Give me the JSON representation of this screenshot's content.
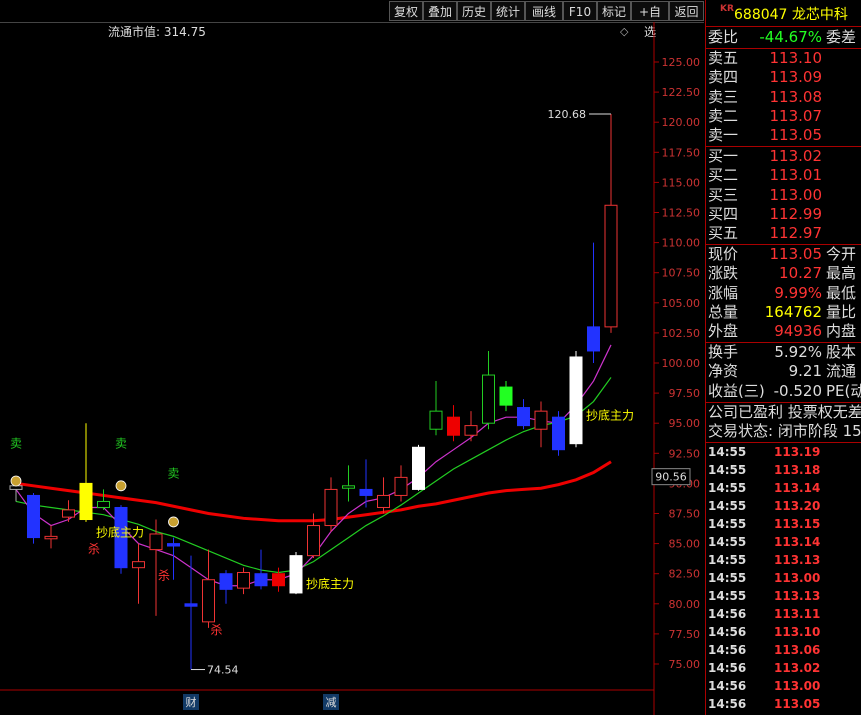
{
  "toolbar": {
    "buttons": [
      "复权",
      "叠加",
      "历史",
      "统计",
      "画线",
      "F10",
      "标记",
      "+自选",
      "返回"
    ]
  },
  "chart_header": {
    "market_cap_label": "流通市值: 314.75",
    "diamond": "◇"
  },
  "chart_data": {
    "type": "candlestick",
    "y_ticks": [
      75.0,
      77.5,
      80.0,
      82.5,
      85.0,
      87.5,
      90.0,
      92.5,
      95.0,
      97.5,
      100.0,
      102.5,
      105.0,
      107.5,
      110.0,
      112.5,
      115.0,
      117.5,
      120.0,
      122.5,
      125.0
    ],
    "ylim": [
      73.5,
      126.5
    ],
    "current_price_label": "90.56",
    "max_label": "120.68",
    "min_label": "74.54",
    "candles": [
      {
        "o": 89.8,
        "c": 89.5,
        "h": 90.5,
        "l": 88.5,
        "color": "gray"
      },
      {
        "o": 89.0,
        "c": 85.5,
        "h": 89.2,
        "l": 85.0,
        "color": "blue"
      },
      {
        "o": 85.6,
        "c": 85.4,
        "h": 86.5,
        "l": 84.6,
        "color": "red"
      },
      {
        "o": 87.2,
        "c": 87.8,
        "h": 88.6,
        "l": 86.8,
        "color": "red"
      },
      {
        "o": 87.0,
        "c": 90.0,
        "h": 95.0,
        "l": 86.8,
        "color": "yellow"
      },
      {
        "o": 88.5,
        "c": 88.0,
        "h": 89.5,
        "l": 87.8,
        "color": "green"
      },
      {
        "o": 88.0,
        "c": 83.0,
        "h": 88.2,
        "l": 82.5,
        "color": "blue"
      },
      {
        "o": 83.0,
        "c": 83.5,
        "h": 85.0,
        "l": 80.0,
        "color": "red"
      },
      {
        "o": 84.5,
        "c": 85.8,
        "h": 87.0,
        "l": 79.0,
        "color": "red"
      },
      {
        "o": 85.0,
        "c": 84.8,
        "h": 85.5,
        "l": 82.0,
        "color": "blue"
      },
      {
        "o": 80.0,
        "c": 79.8,
        "h": 84.0,
        "l": 74.54,
        "color": "blue"
      },
      {
        "o": 78.5,
        "c": 82.0,
        "h": 84.5,
        "l": 78.0,
        "color": "red"
      },
      {
        "o": 82.5,
        "c": 81.2,
        "h": 82.8,
        "l": 80.0,
        "color": "blue"
      },
      {
        "o": 81.3,
        "c": 82.6,
        "h": 83.0,
        "l": 80.8,
        "color": "red"
      },
      {
        "o": 82.5,
        "c": 81.5,
        "h": 84.5,
        "l": 81.2,
        "color": "blue"
      },
      {
        "o": 81.5,
        "c": 82.5,
        "h": 83.0,
        "l": 81.0,
        "color": "redfill"
      },
      {
        "o": 80.9,
        "c": 84.0,
        "h": 84.3,
        "l": 80.8,
        "color": "white"
      },
      {
        "o": 84.0,
        "c": 86.5,
        "h": 87.5,
        "l": 83.8,
        "color": "red"
      },
      {
        "o": 86.5,
        "c": 89.5,
        "h": 90.5,
        "l": 86.0,
        "color": "red"
      },
      {
        "o": 89.6,
        "c": 89.8,
        "h": 91.5,
        "l": 88.5,
        "color": "green"
      },
      {
        "o": 89.5,
        "c": 89.0,
        "h": 92.0,
        "l": 88.0,
        "color": "blue"
      },
      {
        "o": 88.0,
        "c": 89.0,
        "h": 90.5,
        "l": 87.5,
        "color": "red"
      },
      {
        "o": 89.0,
        "c": 90.5,
        "h": 91.5,
        "l": 88.5,
        "color": "red"
      },
      {
        "o": 89.5,
        "c": 93.0,
        "h": 93.2,
        "l": 89.4,
        "color": "white"
      },
      {
        "o": 94.5,
        "c": 96.0,
        "h": 98.5,
        "l": 94.0,
        "color": "green"
      },
      {
        "o": 95.5,
        "c": 94.0,
        "h": 96.5,
        "l": 93.5,
        "color": "redfill"
      },
      {
        "o": 94.0,
        "c": 94.8,
        "h": 96.0,
        "l": 93.5,
        "color": "red"
      },
      {
        "o": 95.0,
        "c": 99.0,
        "h": 101.0,
        "l": 94.5,
        "color": "green"
      },
      {
        "o": 98.0,
        "c": 96.5,
        "h": 98.5,
        "l": 96.0,
        "color": "greenfill"
      },
      {
        "o": 96.3,
        "c": 94.8,
        "h": 97.0,
        "l": 94.5,
        "color": "blue"
      },
      {
        "o": 96.0,
        "c": 94.5,
        "h": 96.8,
        "l": 93.0,
        "color": "red"
      },
      {
        "o": 95.5,
        "c": 92.8,
        "h": 96.0,
        "l": 92.3,
        "color": "blue"
      },
      {
        "o": 93.3,
        "c": 100.5,
        "h": 101.0,
        "l": 93.0,
        "color": "white"
      },
      {
        "o": 101.0,
        "c": 103.0,
        "h": 110.0,
        "l": 100.0,
        "color": "blue"
      },
      {
        "o": 103.0,
        "c": 113.1,
        "h": 120.68,
        "l": 102.5,
        "color": "red"
      }
    ],
    "ma_short": [
      89.5,
      87.5,
      86.5,
      87.0,
      88.0,
      88.0,
      86.5,
      85.0,
      84.5,
      84.0,
      83.0,
      82.0,
      81.5,
      81.5,
      82.0,
      82.0,
      82.5,
      84.0,
      86.0,
      87.5,
      88.5,
      88.8,
      89.5,
      90.5,
      91.8,
      92.8,
      93.8,
      95.0,
      95.5,
      95.5,
      95.2,
      95.0,
      96.5,
      98.5,
      101.5
    ],
    "ma_mid": [
      88.5,
      88.2,
      88.0,
      87.8,
      87.6,
      87.4,
      87.0,
      86.6,
      86.0,
      85.6,
      85.0,
      84.4,
      83.8,
      83.2,
      82.8,
      82.6,
      82.8,
      83.5,
      84.5,
      85.5,
      86.5,
      87.3,
      88.2,
      89.2,
      90.2,
      91.2,
      92.0,
      92.8,
      93.6,
      94.3,
      94.8,
      95.1,
      95.6,
      96.8,
      98.8
    ],
    "ma_long": [
      90.0,
      89.8,
      89.6,
      89.4,
      89.2,
      89.0,
      88.8,
      88.6,
      88.4,
      88.1,
      87.8,
      87.5,
      87.3,
      87.1,
      87.0,
      86.9,
      86.9,
      86.9,
      87.0,
      87.2,
      87.4,
      87.6,
      87.8,
      88.1,
      88.3,
      88.6,
      88.9,
      89.2,
      89.4,
      89.5,
      89.6,
      89.9,
      90.3,
      90.9,
      91.8
    ],
    "annotations": [
      {
        "text": "卖",
        "idx": 0,
        "y": 93.0,
        "color": "green"
      },
      {
        "text": "卖",
        "idx": 6,
        "y": 93.0,
        "color": "green"
      },
      {
        "text": "卖",
        "idx": 9,
        "y": 90.5,
        "color": "green"
      },
      {
        "text": "抄底主力",
        "idx": 4,
        "y": 85.6,
        "color": "yellow"
      },
      {
        "text": "抄底主力",
        "idx": 16,
        "y": 81.3,
        "color": "yellow"
      },
      {
        "text": "抄底主力",
        "idx": 32,
        "y": 95.3,
        "color": "yellow"
      },
      {
        "text": "杀",
        "idx": 4,
        "y": 84.2,
        "color": "red"
      },
      {
        "text": "杀",
        "idx": 8,
        "y": 82.0,
        "color": "red"
      },
      {
        "text": "杀",
        "idx": 11,
        "y": 77.5,
        "color": "red"
      }
    ],
    "bottom_labels": [
      {
        "text": "财",
        "idx": 10
      },
      {
        "text": "减",
        "idx": 18
      }
    ]
  },
  "side": {
    "market": "KR",
    "code_name": "688047 龙芯中科",
    "webi": {
      "label": "委比",
      "value": "-44.67%",
      "right": "委差"
    },
    "asks": [
      {
        "label": "卖五",
        "price": "113.10"
      },
      {
        "label": "卖四",
        "price": "113.09"
      },
      {
        "label": "卖三",
        "price": "113.08"
      },
      {
        "label": "卖二",
        "price": "113.07"
      },
      {
        "label": "卖一",
        "price": "113.05"
      }
    ],
    "bids": [
      {
        "label": "买一",
        "price": "113.02"
      },
      {
        "label": "买二",
        "price": "113.01"
      },
      {
        "label": "买三",
        "price": "113.00"
      },
      {
        "label": "买四",
        "price": "112.99"
      },
      {
        "label": "买五",
        "price": "112.97"
      }
    ],
    "quote": [
      {
        "label": "现价",
        "value": "113.05",
        "right": "今开",
        "color": "#f33"
      },
      {
        "label": "涨跌",
        "value": "10.27",
        "right": "最高",
        "color": "#f33"
      },
      {
        "label": "涨幅",
        "value": "9.99%",
        "right": "最低",
        "color": "#f33"
      },
      {
        "label": "总量",
        "value": "164762",
        "right": "量比",
        "color": "#ff0"
      },
      {
        "label": "外盘",
        "value": "94936",
        "right": "内盘",
        "color": "#f33"
      }
    ],
    "fund": [
      {
        "label": "换手",
        "value": "5.92%",
        "right": "股本",
        "color": "#ddd"
      },
      {
        "label": "净资",
        "value": "9.21",
        "right": "流通",
        "color": "#ddd"
      },
      {
        "label": "收益(三)",
        "value": "-0.520",
        "right": "PE(动",
        "color": "#ddd"
      }
    ],
    "notes": [
      "公司已盈利 投票权无差",
      "交易状态: 闭市阶段 15"
    ],
    "ticks": [
      {
        "t": "14:55",
        "p": "113.19"
      },
      {
        "t": "14:55",
        "p": "113.18"
      },
      {
        "t": "14:55",
        "p": "113.14"
      },
      {
        "t": "14:55",
        "p": "113.20"
      },
      {
        "t": "14:55",
        "p": "113.15"
      },
      {
        "t": "14:55",
        "p": "113.14"
      },
      {
        "t": "14:55",
        "p": "113.13"
      },
      {
        "t": "14:55",
        "p": "113.00"
      },
      {
        "t": "14:55",
        "p": "113.13"
      },
      {
        "t": "14:56",
        "p": "113.11"
      },
      {
        "t": "14:56",
        "p": "113.10"
      },
      {
        "t": "14:56",
        "p": "113.06"
      },
      {
        "t": "14:56",
        "p": "113.02"
      },
      {
        "t": "14:56",
        "p": "113.00"
      },
      {
        "t": "14:56",
        "p": "113.05"
      }
    ]
  }
}
